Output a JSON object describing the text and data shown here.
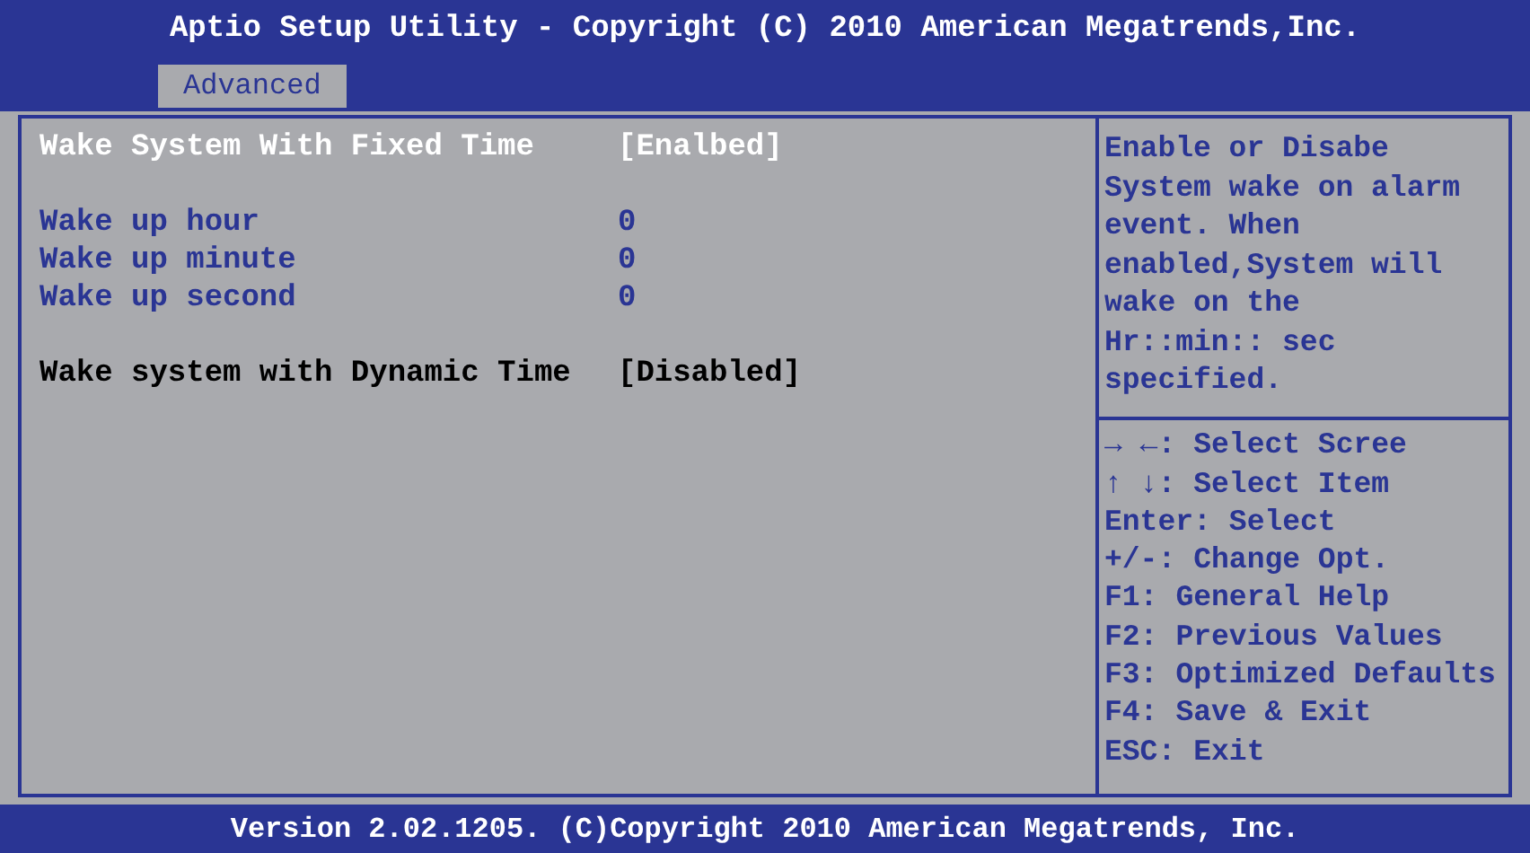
{
  "window": {
    "title": "Aptio Setup Utility - Copyright (C) 2010 American Megatrends,Inc."
  },
  "tabs": [
    {
      "label": "Advanced",
      "selected": true
    }
  ],
  "settings": {
    "groups": [
      {
        "items": [
          {
            "label": "Wake System With Fixed Time",
            "value": "[Enalbed]",
            "disabled": false,
            "selected": true
          }
        ]
      },
      {
        "items": [
          {
            "label": "Wake up hour",
            "value": "0",
            "disabled": false,
            "selected": false
          },
          {
            "label": "Wake up minute",
            "value": "0",
            "disabled": false,
            "selected": false
          },
          {
            "label": "Wake up second",
            "value": "0",
            "disabled": false,
            "selected": false
          }
        ]
      },
      {
        "items": [
          {
            "label": "Wake system with Dynamic Time",
            "value": "[Disabled]",
            "disabled": true,
            "selected": false
          }
        ]
      }
    ]
  },
  "help": {
    "text": "Enable or Disabe System wake on alarm event. When enabled,System will wake on the Hr::min:: sec specified."
  },
  "keys": [
    {
      "key": "→ ←:",
      "action": "Select Scree"
    },
    {
      "key": "↑ ↓:",
      "action": "Select Item"
    },
    {
      "key": "Enter:",
      "action": "Select"
    },
    {
      "key": "+/-:",
      "action": "Change Opt."
    },
    {
      "key": "F1:",
      "action": "General Help"
    },
    {
      "key": "F2:",
      "action": "Previous Values"
    },
    {
      "key": "F3:",
      "action": "Optimized Defaults"
    },
    {
      "key": "F4:",
      "action": "Save & Exit"
    },
    {
      "key": "ESC:",
      "action": "Exit"
    }
  ],
  "status_bar": {
    "text": "Version 2.02.1205. (C)Copyright 2010 American Megatrends, Inc."
  }
}
